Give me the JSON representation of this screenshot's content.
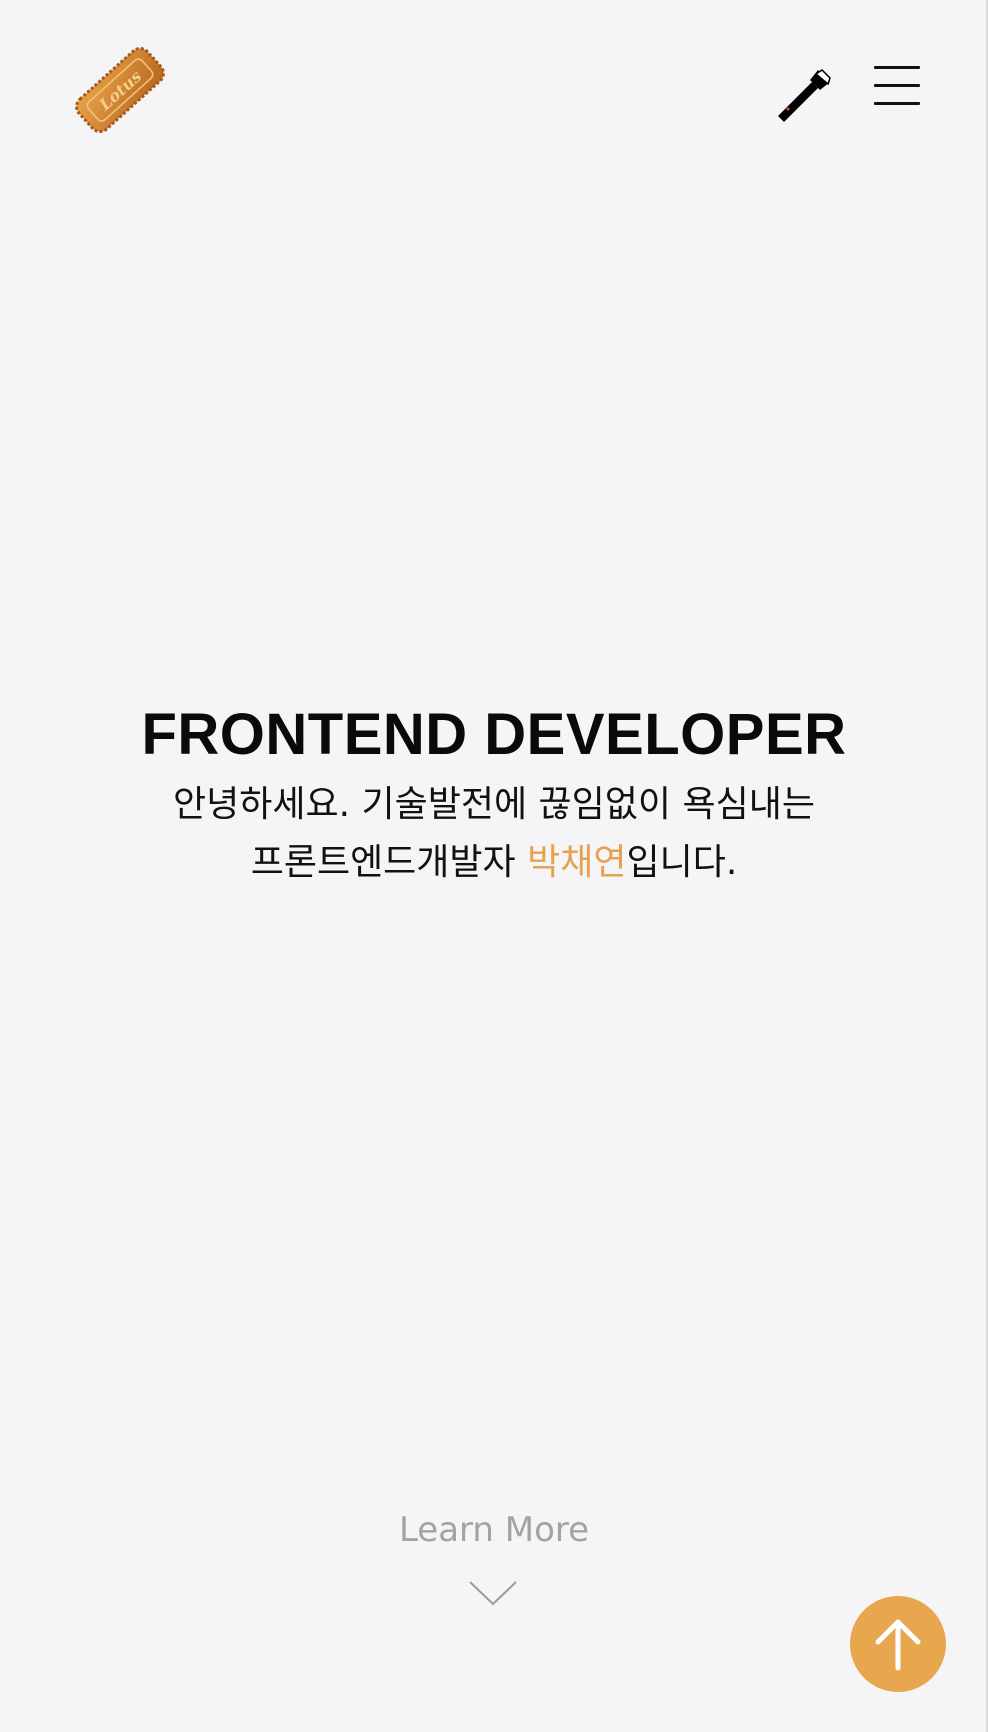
{
  "header": {
    "logo_icon": "lotus-biscuit-logo",
    "logo_text": "Lotus",
    "flashlight_icon": "flashlight-icon",
    "menu_icon": "hamburger-menu-icon"
  },
  "hero": {
    "title": "FRONTEND DEVELOPER",
    "line1": "안녕하세요. 기술발전에 끊임없이 욕심내는",
    "line2_prefix": "프론트엔드개발자 ",
    "name": "박채연",
    "line2_suffix": "입니다."
  },
  "learn_more": {
    "label": "Learn More",
    "icon": "chevron-down-icon"
  },
  "scroll_top": {
    "icon": "arrow-up-icon"
  },
  "colors": {
    "background": "#f5f5f7",
    "accent": "#e8a74f",
    "text": "#111111",
    "muted": "#a3a3a6"
  }
}
